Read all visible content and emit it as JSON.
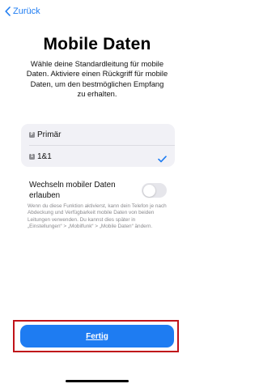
{
  "nav": {
    "back_label": "Zurück"
  },
  "header": {
    "title": "Mobile Daten",
    "subtitle": "Wähle deine Standardleitung für mobile Daten. Aktiviere einen Rückgriff für mobile Daten, um den bestmöglichen Empfang zu erhalten."
  },
  "lines": [
    {
      "badge": "P",
      "label": "Primär",
      "selected": false
    },
    {
      "badge": "1",
      "label": "1&1",
      "selected": true
    }
  ],
  "switching": {
    "label": "Wechseln mobiler Daten erlauben",
    "enabled": false,
    "footnote": "Wenn du diese Funktion aktivierst, kann dein Telefon je nach Abdeckung und Verfügbarkeit mobile Daten von beiden Leitungen verwenden. Du kannst dies später in „Einstellungen“ > „Mobilfunk“ > „Mobile Daten“ ändern."
  },
  "footer": {
    "done_label": "Fertig"
  },
  "colors": {
    "accent": "#1e7cf2",
    "highlight_outline": "#c0141a",
    "group_background": "#f1f1f6",
    "secondary_text": "#8a8a8e"
  },
  "icons": {
    "back": "chevron-left-icon",
    "sim": "sim-card-icon",
    "selected": "checkmark-icon"
  }
}
